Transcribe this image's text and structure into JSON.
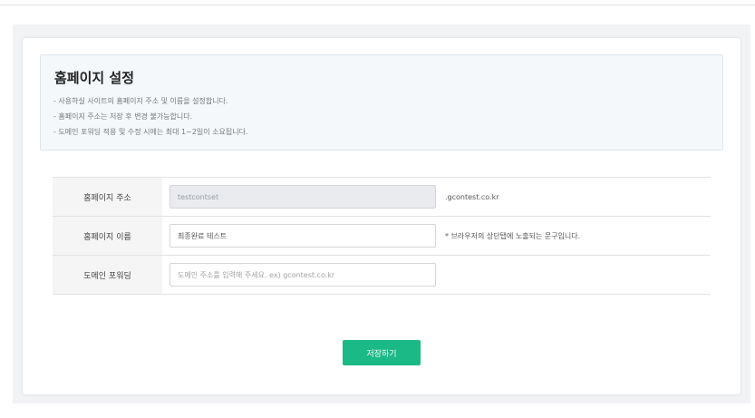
{
  "info": {
    "title": "홈페이지 설정",
    "lines": [
      "- 사용하실 사이트의 홈페이지 주소 및 이름을 설정합니다.",
      "- 홈페이지 주소는 저장 후 변경 불가능합니다.",
      "- 도메인 포워딩 적용 및 수정 시에는 최대 1~2일이 소요됩니다."
    ]
  },
  "form": {
    "address": {
      "label": "홈페이지 주소",
      "value": "testcontset",
      "suffix": ".gcontest.co.kr"
    },
    "name": {
      "label": "홈페이지 이름",
      "value": "최종완료 테스트",
      "note": "* 브라우저의 상단탭에 노출되는 문구입니다."
    },
    "forwarding": {
      "label": "도메인 포워딩",
      "value": "",
      "placeholder": "도메인 주소를 입력해 주세요. ex) gcontest.co.kr"
    }
  },
  "actions": {
    "save_label": "저장하기"
  },
  "colors": {
    "accent": "#1ab985",
    "info_bg": "#f4f8fb"
  }
}
